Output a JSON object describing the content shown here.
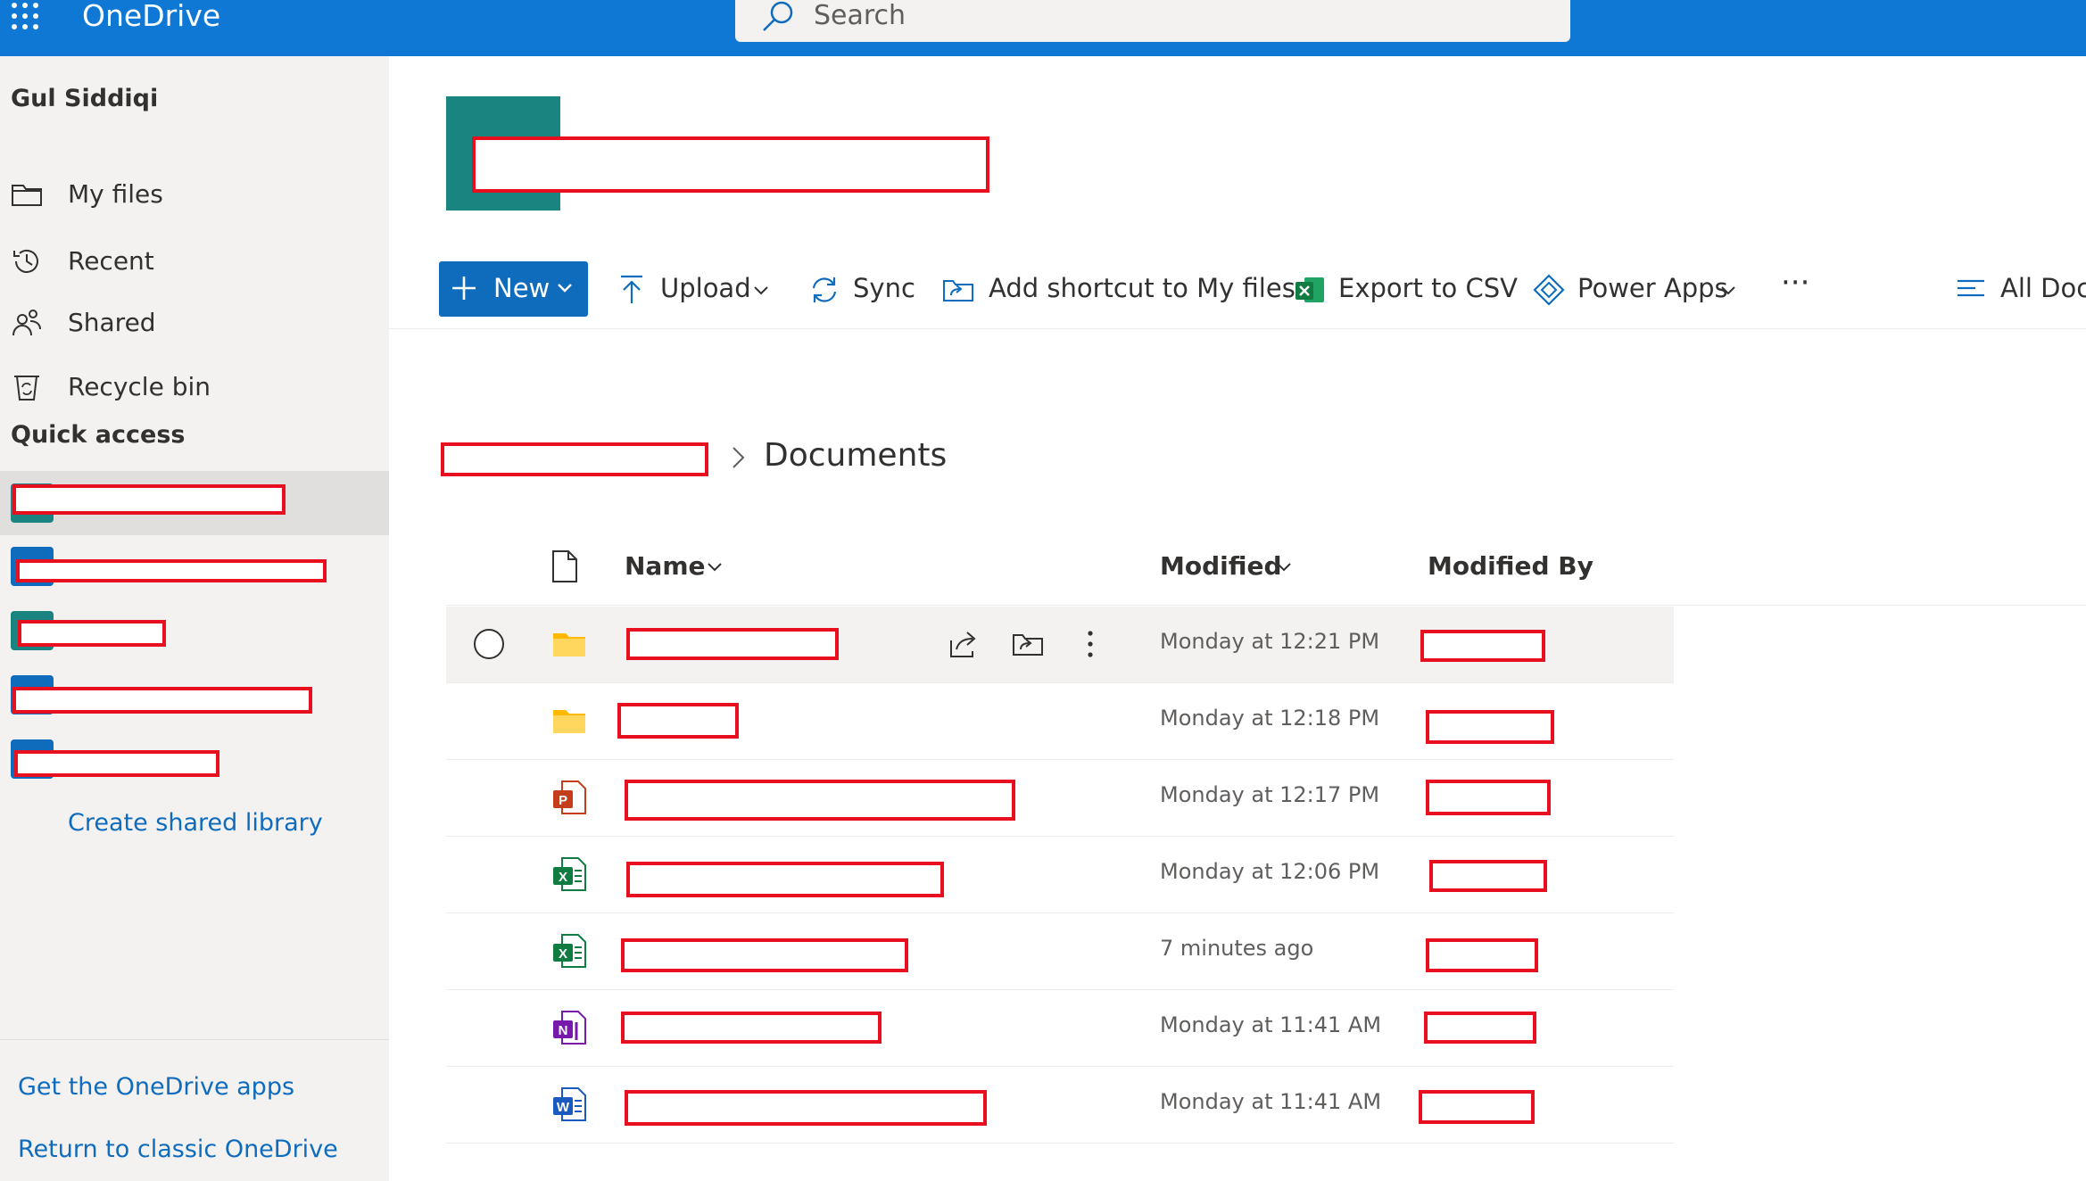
{
  "app": {
    "title": "OneDrive"
  },
  "search": {
    "placeholder": "Search"
  },
  "sidebar": {
    "user": "Gul Siddiqi",
    "items": [
      {
        "label": "My files",
        "icon": "folder-icon"
      },
      {
        "label": "Recent",
        "icon": "history-icon"
      },
      {
        "label": "Shared",
        "icon": "people-icon"
      },
      {
        "label": "Recycle bin",
        "icon": "recycle-bin-icon"
      }
    ],
    "quick_access_label": "Quick access",
    "quick_access_colors": [
      "#1a8580",
      "#0f6cbd",
      "#1a8580",
      "#0f6cbd",
      "#0f6cbd"
    ],
    "create_library": "Create shared library",
    "get_apps": "Get the OneDrive apps",
    "return_classic": "Return to classic OneDrive"
  },
  "toolbar": {
    "new_label": "New",
    "upload_label": "Upload",
    "sync_label": "Sync",
    "add_shortcut_label": "Add shortcut to My files",
    "export_csv_label": "Export to CSV",
    "power_apps_label": "Power Apps",
    "more_label": "···",
    "view_label": "All Docu"
  },
  "breadcrumb": {
    "current": "Documents"
  },
  "table": {
    "columns": {
      "name": "Name",
      "modified": "Modified",
      "modified_by": "Modified By"
    },
    "rows": [
      {
        "type": "folder",
        "modified": "Monday at 12:21 PM"
      },
      {
        "type": "folder",
        "modified": "Monday at 12:18 PM"
      },
      {
        "type": "powerpoint",
        "modified": "Monday at 12:17 PM"
      },
      {
        "type": "excel",
        "modified": "Monday at 12:06 PM"
      },
      {
        "type": "excel",
        "modified": "7 minutes ago"
      },
      {
        "type": "onenote",
        "modified": "Monday at 11:41 AM"
      },
      {
        "type": "word",
        "modified": "Monday at 11:41 AM"
      }
    ]
  },
  "colors": {
    "brand_blue": "#0f78d4",
    "accent": "#0f6cbd",
    "site_logo": "#1a8580",
    "redaction": "#e8101f"
  }
}
